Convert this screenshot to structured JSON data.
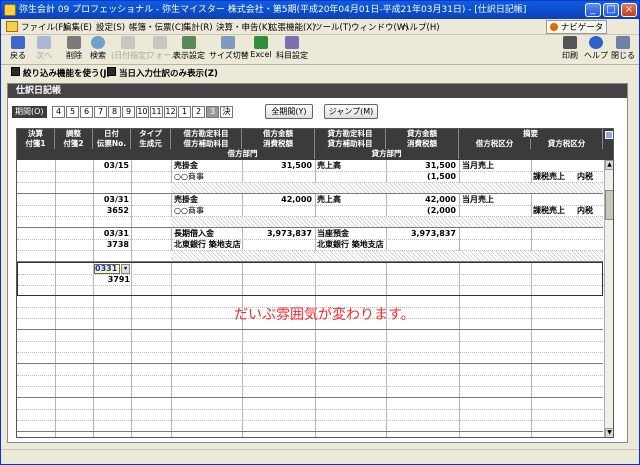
{
  "window": {
    "title": "弥生会計 09 プロフェッショナル - 弥生マイスター 株式会社・第5期(平成20年04月01日-平成21年03月31日) - [仕訳日記帳]",
    "minimize": "_",
    "maximize": "□",
    "close": "×"
  },
  "menu": [
    "ファイル(F)",
    "編集(E)",
    "設定(S)",
    "帳簿・伝票(C)",
    "集計(R)",
    "決算・申告(K)",
    "拡張機能(X)",
    "ツール(T)",
    "ウィンドウ(W)",
    "ヘルプ(H)"
  ],
  "navigator": "ナビゲータ",
  "toolbar": {
    "back": "戻る",
    "next": "次へ",
    "delete": "削除",
    "search": "検索",
    "disabled1": "(日付指定)",
    "disabled2": "フォーム",
    "display_settings": "表示設定",
    "size_switch": "サイズ切替",
    "excel": "Excel",
    "account_settings": "科目設定",
    "print": "印刷",
    "help": "ヘルプ",
    "close": "閉じる"
  },
  "filters": {
    "filter_on": "絞り込み機能を使う(J)",
    "current_only": "当日入力仕訳のみ表示(Z)"
  },
  "section_title": "仕訳日記帳",
  "period": {
    "label": "期間(O)",
    "months": [
      "4",
      "5",
      "6",
      "7",
      "8",
      "9",
      "10",
      "11",
      "12",
      "1",
      "2",
      "3",
      "決"
    ],
    "current_index": 11,
    "all_period": "全期間(Y)",
    "jump": "ジャンプ(M)"
  },
  "grid_headers": {
    "settle": "決算",
    "adjust": "調整",
    "date": "日付",
    "type": "タイプ",
    "tag1": "付箋1",
    "tag2": "付箋2",
    "slip_no": "伝票No.",
    "origin": "生成元",
    "debit_account": "借方勘定科目",
    "debit_sub": "借方補助科目",
    "debit_dept": "借方部門",
    "debit_amount": "借方金額",
    "debit_tax": "消費税額",
    "credit_account": "貸方勘定科目",
    "credit_sub": "貸方補助科目",
    "credit_dept": "貸方部門",
    "credit_amount": "貸方金額",
    "credit_tax": "消費税額",
    "memo": "摘要",
    "debit_taxcat": "借方税区分",
    "credit_taxcat": "貸方税区分"
  },
  "entries": [
    {
      "date": "03/15",
      "slip": "",
      "debit_account": "売掛金",
      "debit_sub": "○○商事",
      "debit_amount": "31,500",
      "debit_tax": "",
      "credit_account": "売上高",
      "credit_sub": "",
      "credit_amount": "31,500",
      "credit_tax": "(1,500",
      "memo": "当月売上",
      "debit_taxcat": "",
      "credit_taxcat": "課税売上",
      "credit_taxcat2": "内税"
    },
    {
      "date": "03/31",
      "slip": "3652",
      "debit_account": "売掛金",
      "debit_sub": "○○商事",
      "debit_amount": "42,000",
      "debit_tax": "",
      "credit_account": "売上高",
      "credit_sub": "",
      "credit_amount": "42,000",
      "credit_tax": "(2,000",
      "memo": "当月売上",
      "debit_taxcat": "",
      "credit_taxcat": "課税売上",
      "credit_taxcat2": "内税"
    },
    {
      "date": "03/31",
      "slip": "3738",
      "debit_account": "長期借入金",
      "debit_sub": "北東銀行 築地支店",
      "debit_amount": "3,973,837",
      "debit_tax": "",
      "credit_account": "当座預金",
      "credit_sub": "北東銀行 築地支店",
      "credit_amount": "3,973,837",
      "credit_tax": "",
      "memo": "",
      "debit_taxcat": "",
      "credit_taxcat": "",
      "credit_taxcat2": ""
    }
  ],
  "new_entry": {
    "date": "0331",
    "slip": "3791"
  },
  "annotation": "だいぶ雰囲気が変わります。"
}
